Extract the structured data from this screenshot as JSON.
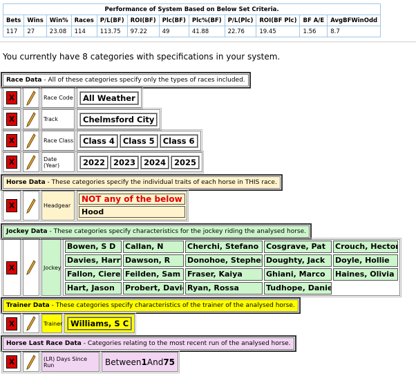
{
  "summary": {
    "title": "Performance of System Based on Below Set Criteria.",
    "headers": [
      "Bets",
      "Wins",
      "Win%",
      "Races",
      "P/L(BF)",
      "ROI(BF)",
      "Plc(BF)",
      "Plc%(BF)",
      "P/L(Plc)",
      "ROI(BF Plc)",
      "BF A/E",
      "AvgBFWinOdd"
    ],
    "values": [
      "117",
      "27",
      "23.08",
      "114",
      "113.75",
      "97.22",
      "49",
      "41.88",
      "22.76",
      "19.45",
      "1.56",
      "8.7"
    ]
  },
  "intro": "You currently have 8 categories with specifications in your system.",
  "colors": {
    "race": "#ffffff",
    "horse": "#fff3cc",
    "jockey": "#ccf5cc",
    "trainer": "#ffff00",
    "lastrace": "#f2d5f2",
    "delete": "#dd0000"
  },
  "sections": {
    "race": {
      "title": "Race Data",
      "desc": " - All of these categories specify only the types of races included."
    },
    "horse": {
      "title": "Horse Data",
      "desc": " - These categories specify the individual traits of each horse in THIS race."
    },
    "jockey": {
      "title": "Jockey Data",
      "desc": " - These categories specify characteristics for the jockey riding the analysed horse."
    },
    "trainer": {
      "title": "Trainer Data",
      "desc": " - These categories specify characteristics of the trainer of the analysed horse."
    },
    "lastrace": {
      "title": "Horse Last Race Data",
      "desc": " - Categories relating to the most recent run of the analysed horse."
    }
  },
  "delete_label": "X",
  "icons": {
    "delete": "delete-x-icon",
    "edit": "pencil-icon"
  },
  "race_code": {
    "label": "Race Code",
    "values": [
      "All Weather"
    ]
  },
  "track": {
    "label": "Track",
    "values": [
      "Chelmsford City"
    ]
  },
  "race_class": {
    "label": "Race Class",
    "values": [
      "Class 4",
      "Class 5",
      "Class 6"
    ]
  },
  "date_year": {
    "label": "Date (Year)",
    "values": [
      "2022",
      "2023",
      "2024",
      "2025"
    ]
  },
  "headgear": {
    "label": "Headgear",
    "qualifier": "NOT any of the below",
    "values": [
      "Hood"
    ]
  },
  "jockey": {
    "label": "Jockey",
    "names": [
      "Bowen, S D",
      "Callan, N",
      "Cherchi, Stefano",
      "Cosgrave, Pat",
      "Crouch, Hector",
      "Davies, Harry",
      "Dawson, R",
      "Donohoe, Stephen",
      "Doughty, Jack",
      "Doyle, Hollie",
      "Fallon, Cieren",
      "Feilden, Sam",
      "Fraser, Kaiya",
      "Ghiani, Marco",
      "Haines, Olivia",
      "Hart, Jason",
      "Probert, David",
      "Ryan, Rossa",
      "Tudhope, Daniel"
    ]
  },
  "trainer": {
    "label": "Trainer",
    "values": [
      "Williams, S C"
    ]
  },
  "days_since_run": {
    "label": "(LR) Days Since Run",
    "prefix": "Between ",
    "from": "1",
    "mid": " And ",
    "to": "75"
  }
}
